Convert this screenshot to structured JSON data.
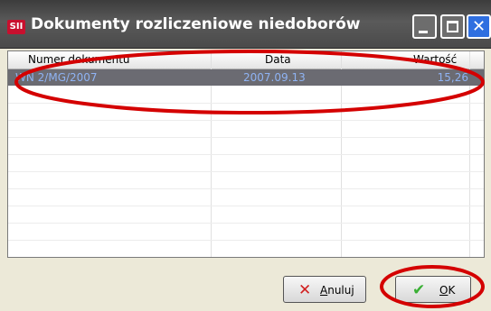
{
  "window": {
    "title": "Dokumenty rozliczeniowe niedoborów",
    "app_icon": "SII"
  },
  "table": {
    "columns": [
      "Numer dokumentu",
      "Data",
      "Wartość"
    ],
    "rows": [
      {
        "numer": "WN 2/MG/2007",
        "data": "2007.09.13",
        "wartosc": "15,26"
      }
    ]
  },
  "buttons": {
    "cancel": {
      "accel": "A",
      "rest": "nuluj"
    },
    "ok": {
      "accel": "O",
      "rest": "K"
    }
  },
  "colors": {
    "selection": "#6b6b72",
    "selection_text": "#8fb3f3",
    "annotation": "#d40000"
  },
  "icons": {
    "cancel": "x-icon",
    "ok": "check-icon"
  }
}
